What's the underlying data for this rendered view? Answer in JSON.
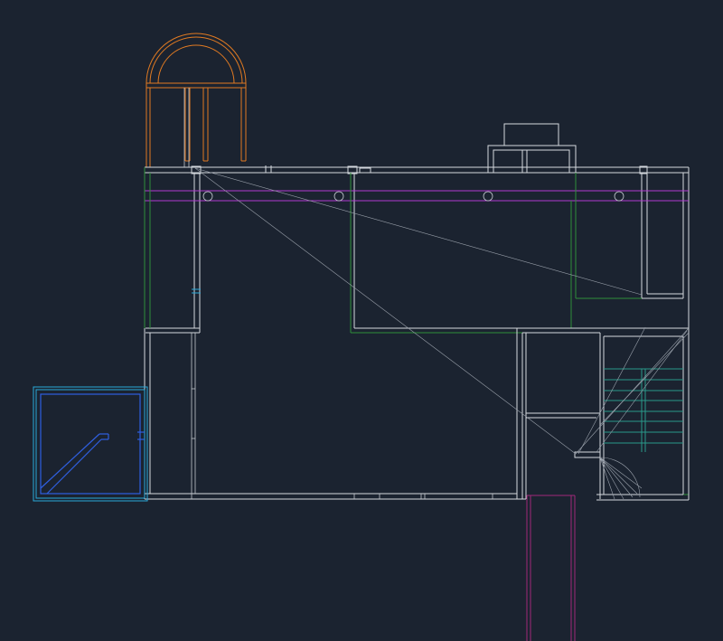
{
  "canvas": {
    "background": "#1b2330"
  },
  "palette": {
    "wall": "#d4d8de",
    "green_layer": "#2f8f3a",
    "magenta_layer": "#b23ad0",
    "orange_layer": "#e07a22",
    "cyan_layer": "#2aa8d8",
    "blue_layer": "#2f5fe0",
    "teal_layer": "#2a9a8a",
    "purple_layer": "#a0287a"
  }
}
